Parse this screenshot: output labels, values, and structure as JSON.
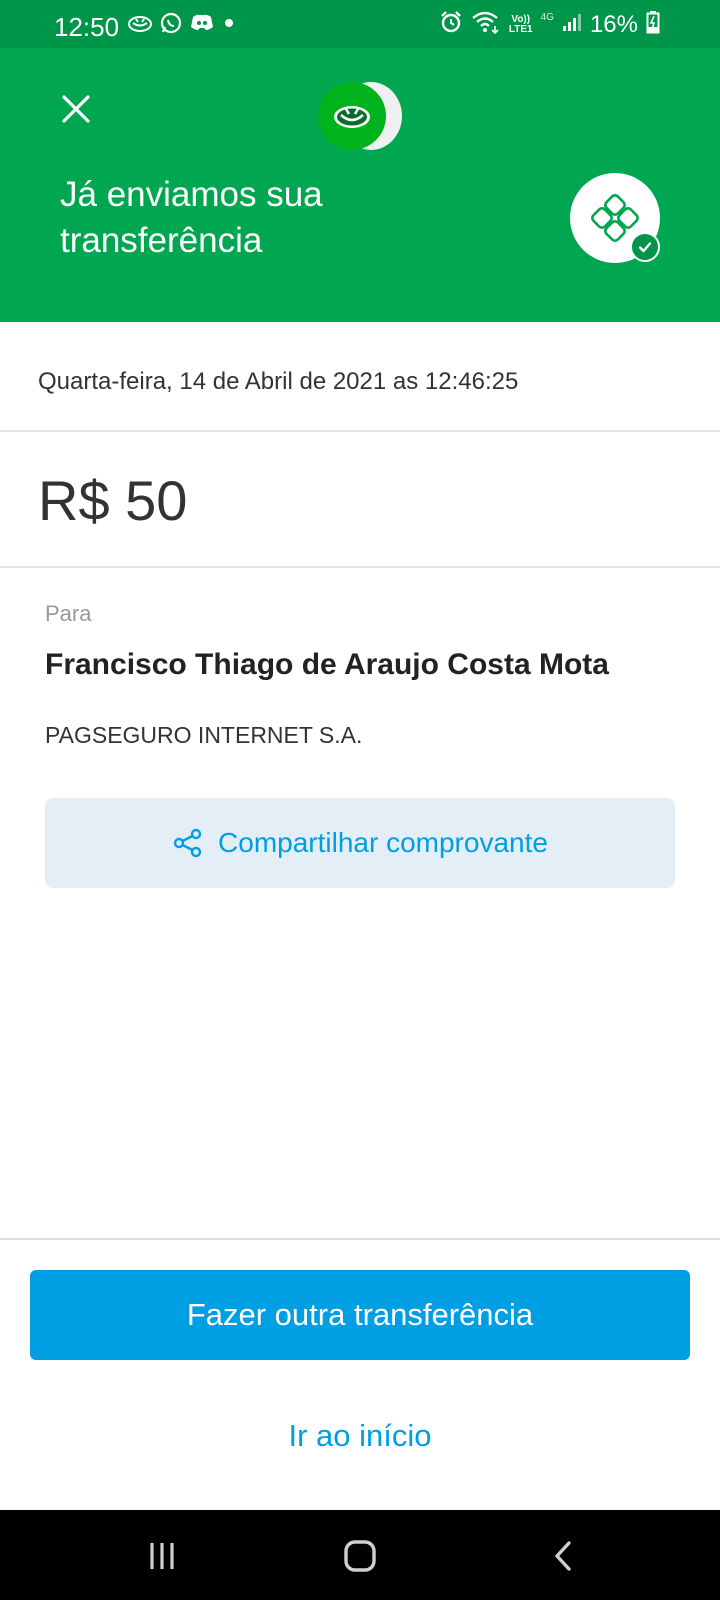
{
  "status_bar": {
    "time": "12:50",
    "battery": "16%",
    "volte_top": "Vo))",
    "volte_bottom": "LTE1",
    "network": "4G",
    "icons": [
      "mercadopago-notification-icon",
      "whatsapp-icon",
      "discord-icon",
      "dot-icon",
      "alarm-icon",
      "wifi-icon",
      "signal-icon",
      "battery-charging-icon"
    ]
  },
  "header": {
    "title": "Já enviamos sua transferência",
    "close_icon": "close-icon",
    "logo_icon": "mercadopago-logo-icon",
    "badge_icon": "pix-icon",
    "check_icon": "check-icon"
  },
  "transfer": {
    "datetime": "Quarta-feira, 14 de Abril de 2021 as 12:46:25",
    "amount": "R$ 50",
    "to_label": "Para",
    "recipient_name": "Francisco Thiago de Araujo Costa Mota",
    "recipient_bank": "PAGSEGURO INTERNET S.A."
  },
  "actions": {
    "share_label": "Compartilhar comprovante",
    "share_icon": "share-icon",
    "primary_label": "Fazer outra transferência",
    "secondary_label": "Ir ao início"
  },
  "nav_bar": {
    "buttons": [
      "recent-apps-icon",
      "home-icon",
      "back-icon"
    ]
  },
  "colors": {
    "header_green": "#00a650",
    "status_green": "#00964a",
    "primary_blue": "#009ee3",
    "share_bg": "#e3eef7"
  }
}
